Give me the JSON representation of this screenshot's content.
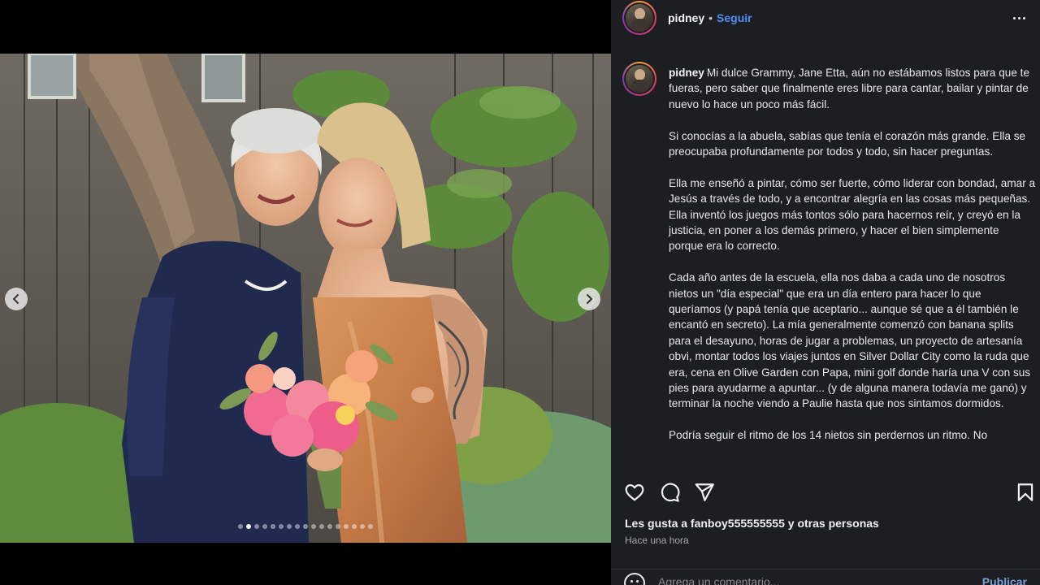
{
  "post": {
    "username": "pidney",
    "separator": "•",
    "follow_label": "Seguir",
    "more_icon": "more-horizontal-icon",
    "caption_user": "pidney",
    "caption_paragraphs": [
      "Mi dulce Grammy, Jane Etta, aún no estábamos listos para que te fueras, pero saber que finalmente eres libre para cantar, bailar y pintar de nuevo lo hace un poco más fácil.",
      "Si conocías a la abuela, sabías que tenía el corazón más grande. Ella se preocupaba profundamente por todos y todo, sin hacer preguntas.",
      "Ella me enseñó a pintar, cómo ser fuerte, cómo liderar con bondad, amar a Jesús a través de todo, y a encontrar alegría en las cosas más pequeñas. Ella inventó los juegos más tontos sólo para hacernos reír, y creyó en la justicia, en poner a los demás primero, y hacer el bien simplemente porque era lo correcto.",
      "Cada año antes de la escuela, ella nos daba a cada uno de nosotros nietos un \"día especial\" que era un día entero para hacer lo que queríamos (y papá tenía que aceptario... aunque sé que a él también le encantó en secreto). La mía generalmente comenzó con banana splits para el desayuno, horas de jugar a problemas, un proyecto de artesanía obvi, montar todos los viajes juntos en Silver Dollar City como la ruda que era, cena en Olive Garden con Papa, mini golf donde haría una V con sus pies para ayudarme a apuntar... (y de alguna manera todavía me ganó) y terminar la noche viendo a Paulie hasta que nos sintamos dormidos.",
      "Podría seguir el ritmo de los 14 nietos sin perdernos un ritmo. No"
    ],
    "likes_text": "Les gusta a fanboy555555555 y otras personas",
    "timestamp": "Hace una hora",
    "comment_placeholder": "Agrega un comentario...",
    "publish_label": "Publicar"
  },
  "carousel": {
    "total_slides": 17,
    "active_index": 1
  },
  "icons": {
    "like": "heart-icon",
    "comment": "comment-bubble-icon",
    "share": "send-icon",
    "save": "bookmark-icon",
    "prev": "chevron-left-icon",
    "next": "chevron-right-icon",
    "emoji": "smiley-icon"
  },
  "colors": {
    "panel_bg": "#1d1e22",
    "follow_blue": "#4f8ef7",
    "text": "#f5f5f5"
  }
}
